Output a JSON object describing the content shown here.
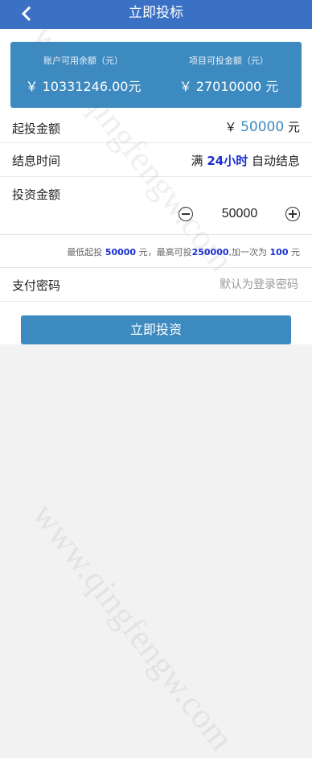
{
  "header": {
    "title": "立即投标"
  },
  "summary": {
    "balance_label": "账户可用余额（元）",
    "balance_value": "￥ 10331246.00元",
    "available_label": "项目可投金额（元）",
    "available_value": "￥ 27010000 元"
  },
  "rows": {
    "min_invest_label": "起投金额",
    "min_invest_currency": "￥",
    "min_invest_value": "50000",
    "min_invest_unit": "元",
    "settle_label": "结息时间",
    "settle_prefix": "满",
    "settle_hours": "24小时",
    "settle_suffix": "自动结息",
    "amount_label": "投资金额",
    "amount_value": "50000"
  },
  "hint": {
    "p1": "最低起投",
    "min": "50000",
    "p2": "元，最高可投",
    "max": "250000",
    "p3": ",加一次为",
    "step": "100",
    "p4": "元"
  },
  "password": {
    "label": "支付密码",
    "placeholder": "默认为登录密码"
  },
  "submit": {
    "label": "立即投资"
  },
  "watermark": {
    "text": "www.qingfengw.com"
  },
  "colors": {
    "header": "#3b71c4",
    "card": "#3d8ac1",
    "accent_blue": "#1a2fd1"
  }
}
